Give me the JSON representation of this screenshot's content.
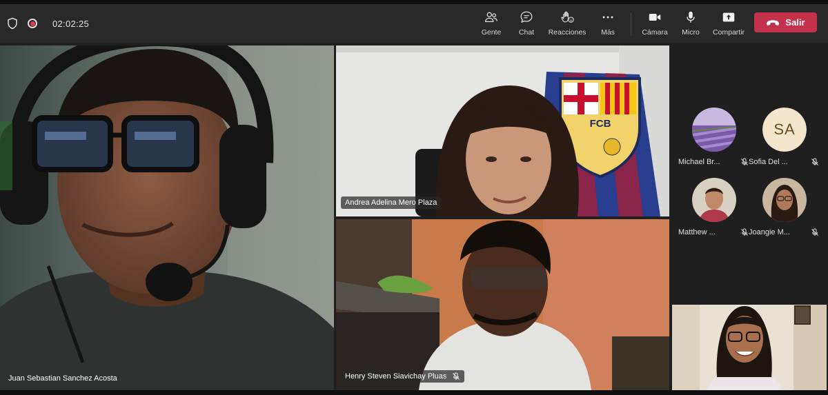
{
  "meeting": {
    "timer": "02:02:25",
    "recording": true
  },
  "toolbar": {
    "people": {
      "label": "Gente",
      "icon": "people-icon"
    },
    "chat": {
      "label": "Chat",
      "icon": "chat-icon"
    },
    "reactions": {
      "label": "Reacciones",
      "icon": "raise-hand-icon"
    },
    "more": {
      "label": "Más",
      "icon": "more-icon"
    },
    "camera": {
      "label": "Cámara",
      "icon": "camera-icon"
    },
    "mic": {
      "label": "Micro",
      "icon": "microphone-icon"
    },
    "share": {
      "label": "Compartir",
      "icon": "share-screen-icon"
    },
    "leave": {
      "label": "Salir",
      "icon": "hang-up-icon"
    }
  },
  "participants_video": [
    {
      "name": "Juan Sebastian Sanchez Acosta",
      "muted": false
    },
    {
      "name": "Andrea Adelina Mero Plaza",
      "muted": false
    },
    {
      "name": "Henry Steven Siavichay Pluas",
      "muted": true
    }
  ],
  "roster": [
    {
      "name": "Michael Br...",
      "initials": "",
      "muted": true
    },
    {
      "name": "Sofia Del ...",
      "initials": "SA",
      "muted": true
    },
    {
      "name": "Matthew ...",
      "initials": "",
      "muted": true
    },
    {
      "name": "Joangie M...",
      "initials": "",
      "muted": true
    }
  ],
  "colors": {
    "toolbar_bg": "#292929",
    "stage_bg": "#1f1f1f",
    "leave_red": "#c4314b",
    "record_red": "#e33a4c"
  }
}
